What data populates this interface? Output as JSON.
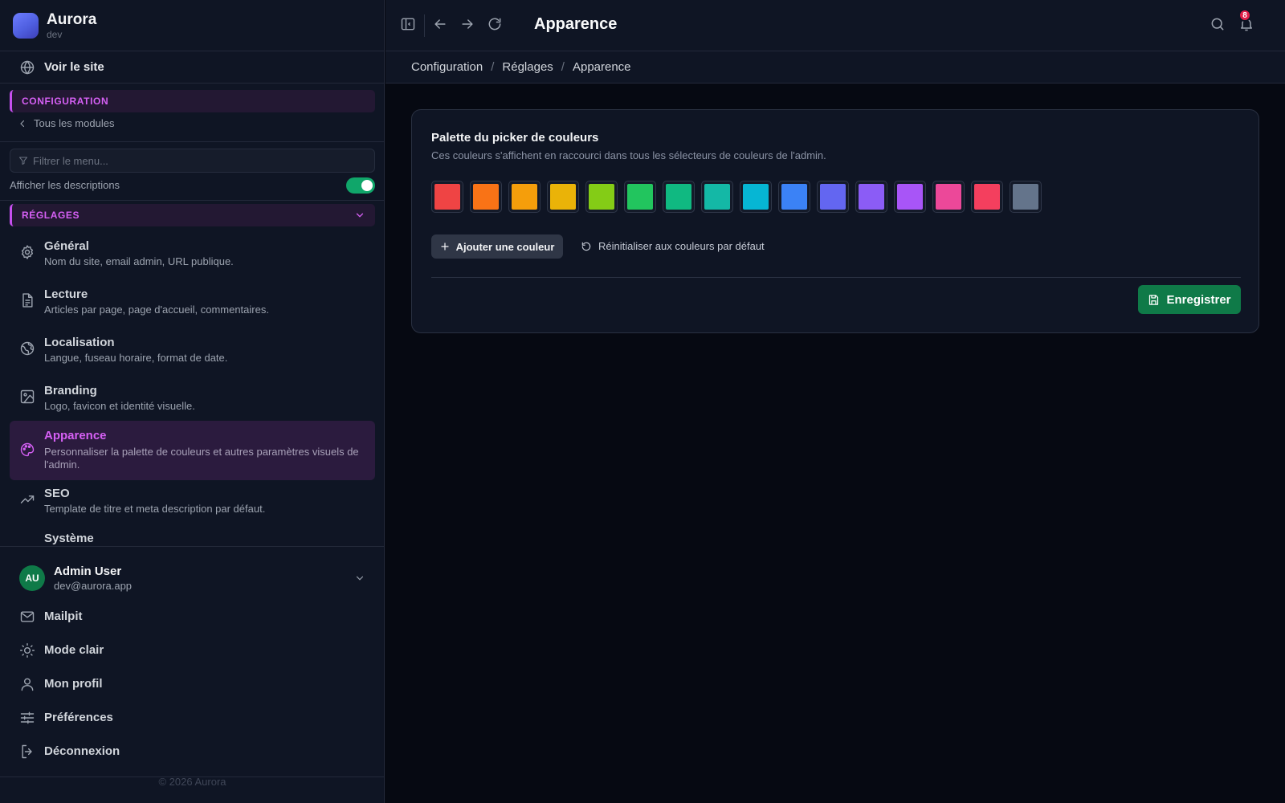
{
  "brand": {
    "name": "Aurora",
    "env": "dev"
  },
  "sidebar": {
    "visit_site": "Voir le site",
    "config_section": "CONFIGURATION",
    "back_link": "Tous les modules",
    "filter_placeholder": "Filtrer le menu...",
    "show_descriptions": "Afficher les descriptions",
    "show_descriptions_on": true,
    "settings_section": "RÉGLAGES",
    "items": [
      {
        "title": "Général",
        "desc": "Nom du site, email admin, URL publique.",
        "icon": "gear-icon"
      },
      {
        "title": "Lecture",
        "desc": "Articles par page, page d'accueil, commentaires.",
        "icon": "document-icon"
      },
      {
        "title": "Localisation",
        "desc": "Langue, fuseau horaire, format de date.",
        "icon": "globe-icon"
      },
      {
        "title": "Branding",
        "desc": "Logo, favicon et identité visuelle.",
        "icon": "image-icon"
      },
      {
        "title": "Apparence",
        "desc": "Personnaliser la palette de couleurs et autres paramètres visuels de l'admin.",
        "icon": "palette-icon",
        "active": true
      },
      {
        "title": "SEO",
        "desc": "Template de titre et meta description par défaut.",
        "icon": "trending-icon"
      },
      {
        "title": "Système",
        "desc": "",
        "icon": ""
      }
    ],
    "user": {
      "initials": "AU",
      "name": "Admin User",
      "email": "dev@aurora.app"
    },
    "footer_links": [
      {
        "label": "Mailpit",
        "icon": "mail-icon"
      },
      {
        "label": "Mode clair",
        "icon": "sun-icon"
      },
      {
        "label": "Mon profil",
        "icon": "user-icon"
      },
      {
        "label": "Préférences",
        "icon": "sliders-icon"
      },
      {
        "label": "Déconnexion",
        "icon": "logout-icon"
      }
    ],
    "copyright": "© 2026 Aurora"
  },
  "topbar": {
    "title": "Apparence",
    "notification_count": "8"
  },
  "breadcrumb": [
    "Configuration",
    "Réglages",
    "Apparence"
  ],
  "card": {
    "title": "Palette du picker de couleurs",
    "subtitle": "Ces couleurs s'affichent en raccourci dans tous les sélecteurs de couleurs de l'admin.",
    "colors": [
      "#ef4444",
      "#f97316",
      "#f59e0b",
      "#eab308",
      "#84cc16",
      "#22c55e",
      "#10b981",
      "#14b8a6",
      "#06b6d4",
      "#3b82f6",
      "#6366f1",
      "#8b5cf6",
      "#a855f7",
      "#ec4899",
      "#f43f5e",
      "#64748b"
    ],
    "add_label": "Ajouter une couleur",
    "reset_label": "Réinitialiser aux couleurs par défaut",
    "save_label": "Enregistrer"
  }
}
